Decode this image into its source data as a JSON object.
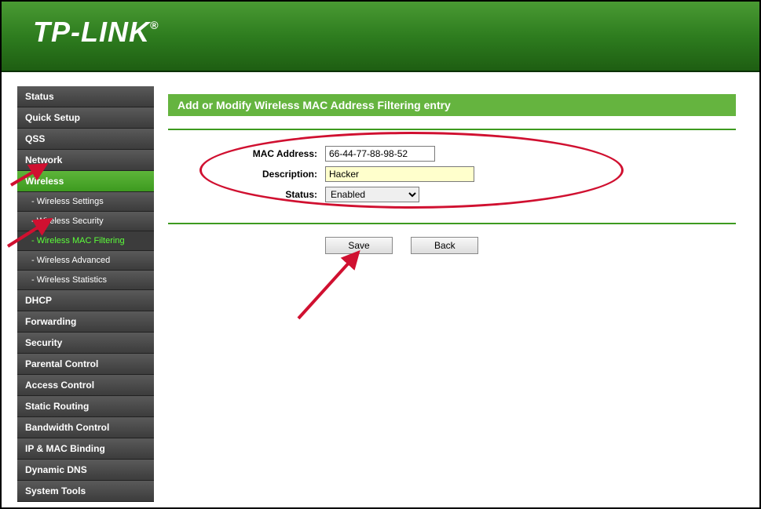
{
  "brand": "TP-LINK",
  "sidebar": {
    "items": [
      {
        "label": "Status",
        "type": "main"
      },
      {
        "label": "Quick Setup",
        "type": "main"
      },
      {
        "label": "QSS",
        "type": "main"
      },
      {
        "label": "Network",
        "type": "main"
      },
      {
        "label": "Wireless",
        "type": "active"
      },
      {
        "label": "- Wireless Settings",
        "type": "sub"
      },
      {
        "label": "- Wireless Security",
        "type": "sub"
      },
      {
        "label": "- Wireless MAC Filtering",
        "type": "sub-active"
      },
      {
        "label": "- Wireless Advanced",
        "type": "sub"
      },
      {
        "label": "- Wireless Statistics",
        "type": "sub"
      },
      {
        "label": "DHCP",
        "type": "main"
      },
      {
        "label": "Forwarding",
        "type": "main"
      },
      {
        "label": "Security",
        "type": "main"
      },
      {
        "label": "Parental Control",
        "type": "main"
      },
      {
        "label": "Access Control",
        "type": "main"
      },
      {
        "label": "Static Routing",
        "type": "main"
      },
      {
        "label": "Bandwidth Control",
        "type": "main"
      },
      {
        "label": "IP & MAC Binding",
        "type": "main"
      },
      {
        "label": "Dynamic DNS",
        "type": "main"
      },
      {
        "label": "System Tools",
        "type": "main"
      }
    ]
  },
  "page": {
    "title": "Add or Modify Wireless MAC Address Filtering entry",
    "form": {
      "mac_label": "MAC Address:",
      "mac_value": "66-44-77-88-98-52",
      "desc_label": "Description:",
      "desc_value": "Hacker",
      "status_label": "Status:",
      "status_value": "Enabled"
    },
    "buttons": {
      "save": "Save",
      "back": "Back"
    }
  }
}
